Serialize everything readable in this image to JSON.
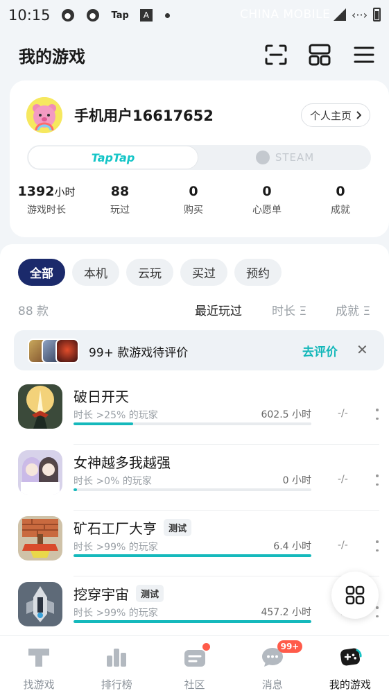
{
  "status_bar": {
    "time": "10:15",
    "tap_label": "Tap",
    "a_label": "A",
    "carrier": "CHINA MOBILE",
    "network": "‹··›"
  },
  "header": {
    "title": "我的游戏",
    "icons": [
      "scan-icon",
      "grid-layout-icon",
      "menu-icon"
    ]
  },
  "profile": {
    "username": "手机用户16617652",
    "home_button": "个人主页",
    "platforms": {
      "taptap": "TapTap",
      "steam": "STEAM",
      "selected": "taptap"
    },
    "stats": [
      {
        "value": "1392",
        "unit": "小时",
        "label": "游戏时长"
      },
      {
        "value": "88",
        "unit": "",
        "label": "玩过"
      },
      {
        "value": "0",
        "unit": "",
        "label": "购买"
      },
      {
        "value": "0",
        "unit": "",
        "label": "心愿单"
      },
      {
        "value": "0",
        "unit": "",
        "label": "成就"
      }
    ]
  },
  "filters": {
    "chips": [
      "全部",
      "本机",
      "云玩",
      "买过",
      "预约"
    ],
    "selected": "全部"
  },
  "sort": {
    "count": "88 款",
    "options": [
      "最近玩过",
      "时长",
      "成就"
    ],
    "active": "最近玩过",
    "sort_glyph": "Ξ"
  },
  "review_banner": {
    "text": "99+ 款游戏待评价",
    "action": "去评价",
    "close": "✕"
  },
  "games": [
    {
      "title": "破日开天",
      "tag": "",
      "sub": "时长 >25% 的玩家",
      "hours": "602.5 小时",
      "progress": 0.25,
      "rating": "-/-"
    },
    {
      "title": "女神越多我越强",
      "tag": "",
      "sub": "时长 >0% 的玩家",
      "hours": "0 小时",
      "progress": 0.0,
      "rating": "-/-"
    },
    {
      "title": "矿石工厂大亨",
      "tag": "测试",
      "sub": "时长 >99% 的玩家",
      "hours": "6.4 小时",
      "progress": 1.0,
      "rating": "-/-"
    },
    {
      "title": "挖穿宇宙",
      "tag": "测试",
      "sub": "时长 >99% 的玩家",
      "hours": "457.2 小时",
      "progress": 1.0,
      "rating": "-/-"
    }
  ],
  "bottom_nav": {
    "items": [
      {
        "label": "找游戏",
        "icon": "find-games-icon"
      },
      {
        "label": "排行榜",
        "icon": "ranking-icon"
      },
      {
        "label": "社区",
        "icon": "community-icon"
      },
      {
        "label": "消息",
        "icon": "message-icon",
        "badge": "99+"
      },
      {
        "label": "我的游戏",
        "icon": "my-games-icon"
      }
    ],
    "active": "我的游戏"
  },
  "colors": {
    "accent": "#15b9bc",
    "chip_active": "#1b2a6b",
    "badge": "#ff5b4a"
  }
}
